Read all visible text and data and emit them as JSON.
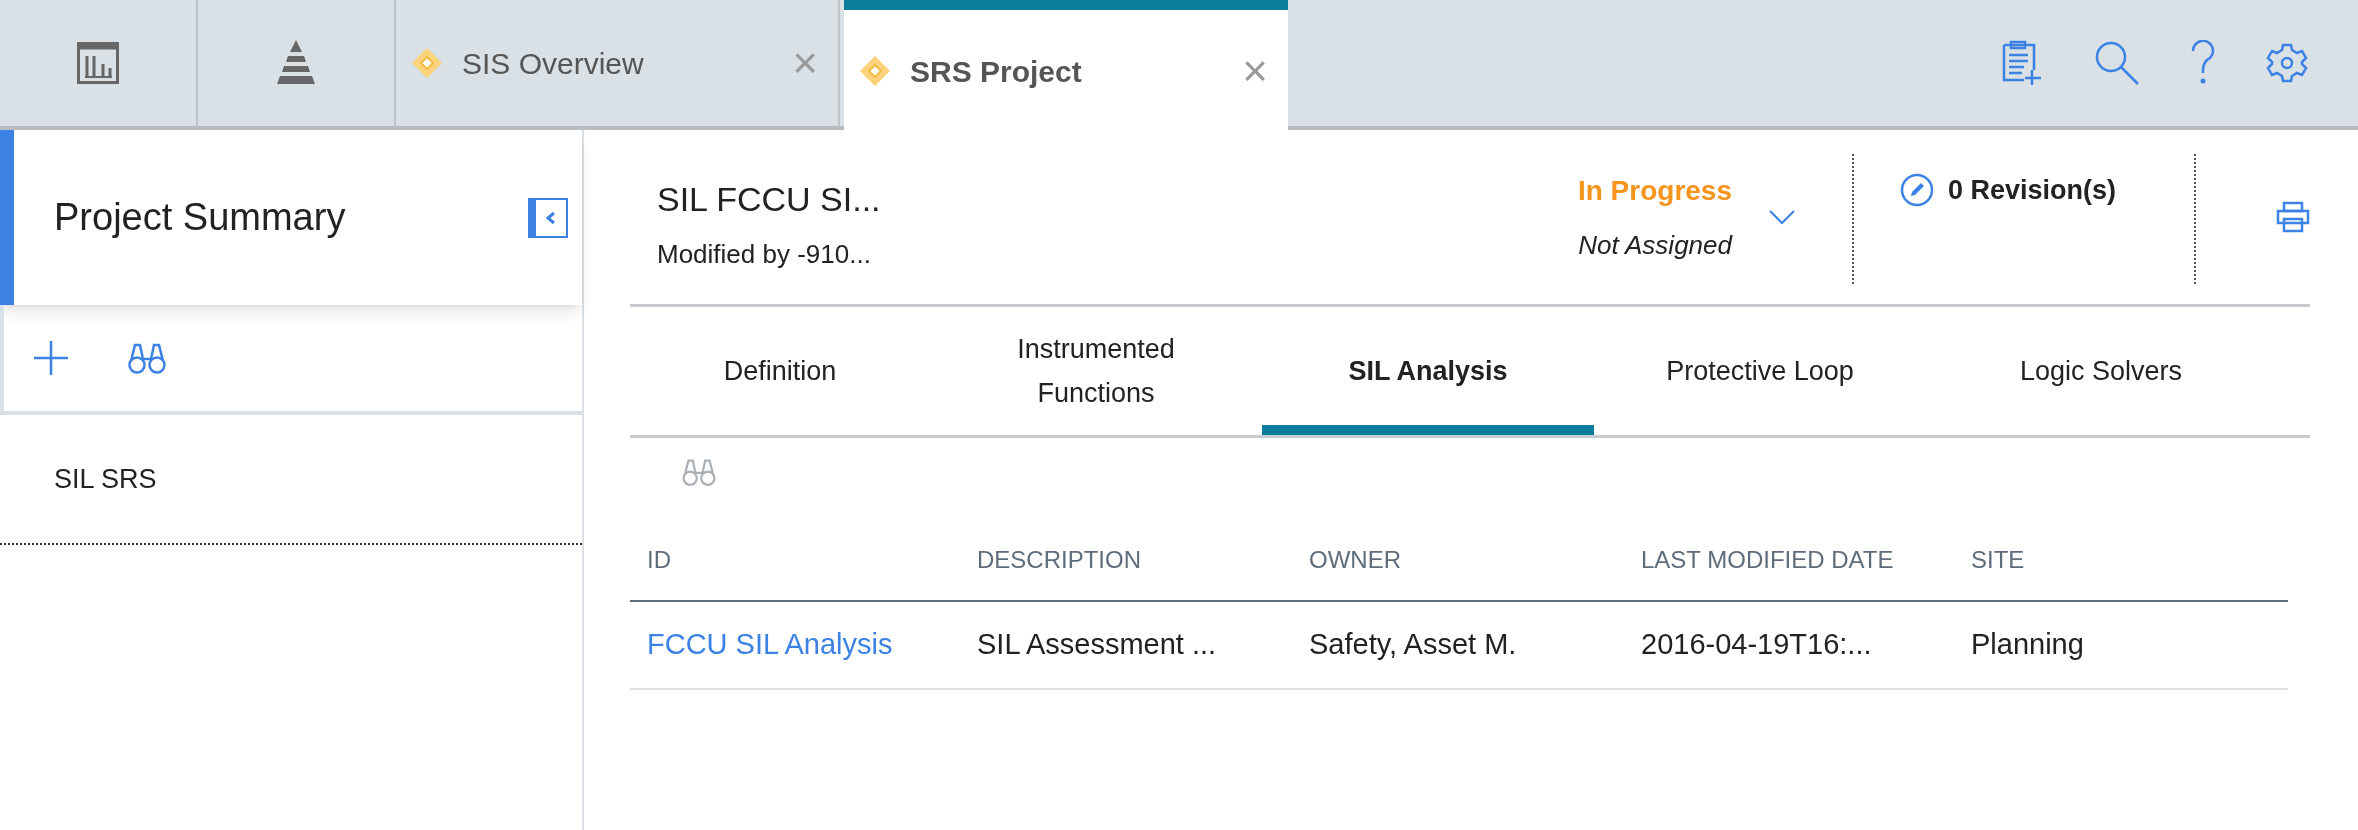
{
  "app_tabs": [
    {
      "kind": "report",
      "selected": false
    },
    {
      "kind": "pyramid",
      "selected": false
    },
    {
      "kind": "doc",
      "label": "SIS Overview",
      "close": "×",
      "selected": false
    },
    {
      "kind": "doc",
      "label": "SRS Project",
      "close": "×",
      "selected": true
    }
  ],
  "sidebar": {
    "title": "Project Summary",
    "items": [
      {
        "label": "SIL SRS",
        "selected": false
      }
    ]
  },
  "header": {
    "title": "SIL FCCU SI...",
    "subtitle": "Modified by -910...",
    "status": "In Progress",
    "assignee": "Not Assigned",
    "revisions": "0 Revision(s)"
  },
  "tabs": [
    {
      "label": "Definition",
      "selected": false
    },
    {
      "label": "Instrumented Functions",
      "selected": false
    },
    {
      "label": "SIL Analysis",
      "selected": true
    },
    {
      "label": "Protective Loop",
      "selected": false
    },
    {
      "label": "Logic Solvers",
      "selected": false
    }
  ],
  "table": {
    "columns": [
      "ID",
      "DESCRIPTION",
      "OWNER",
      "LAST MODIFIED DATE",
      "SITE"
    ],
    "rows": [
      [
        "FCCU SIL Analysis",
        "SIL Assessment ...",
        "Safety, Asset M.",
        "2016-04-19T16:...",
        "Planning"
      ]
    ]
  }
}
